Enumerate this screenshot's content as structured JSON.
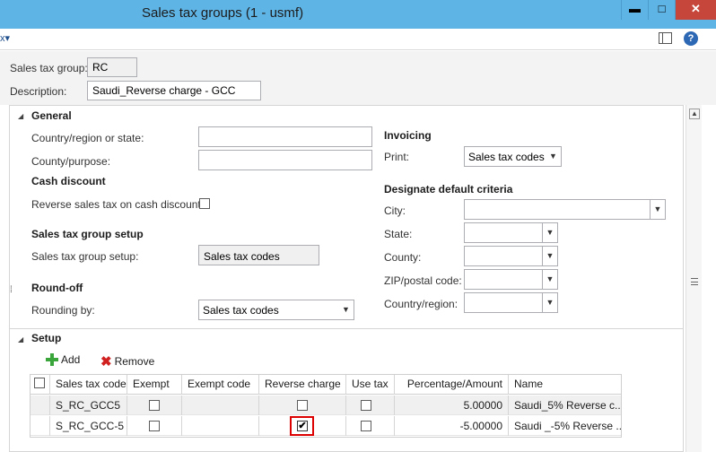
{
  "window": {
    "title": "Sales tax groups (1 - usmf)",
    "min_label": "▬",
    "max_label": "□",
    "close_label": "✕"
  },
  "cmdbar": {
    "menu_label": "x▾",
    "help_label": "?"
  },
  "header": {
    "group_label": "Sales tax group:",
    "group_value": "RC",
    "desc_label": "Description:",
    "desc_value": "Saudi_Reverse charge - GCC"
  },
  "general": {
    "title": "General",
    "country_label": "Country/region or state:",
    "county_label": "County/purpose:",
    "cash_discount_head": "Cash discount",
    "reverse_tax_label": "Reverse sales tax on cash discount:",
    "setup_head": "Sales tax group setup",
    "setup_label": "Sales tax group setup:",
    "setup_value": "Sales tax codes",
    "roundoff_head": "Round-off",
    "rounding_label": "Rounding by:",
    "rounding_value": "Sales tax codes",
    "invoicing_head": "Invoicing",
    "print_label": "Print:",
    "print_value": "Sales tax codes",
    "criteria_head": "Designate default criteria",
    "city_label": "City:",
    "state_label": "State:",
    "county2_label": "County:",
    "zip_label": "ZIP/postal code:",
    "country2_label": "Country/region:"
  },
  "setup": {
    "title": "Setup",
    "add_label": "Add",
    "remove_label": "Remove",
    "columns": [
      "Sales tax code",
      "Exempt",
      "Exempt code",
      "Reverse charge",
      "Use tax",
      "Percentage/Amount",
      "Name"
    ],
    "rows": [
      {
        "code": "S_RC_GCC5",
        "exempt": false,
        "exempt_code": "",
        "reverse_charge": false,
        "use_tax": false,
        "amount": "5.00000",
        "name": "Saudi_5% Reverse c..."
      },
      {
        "code": "S_RC_GCC-5",
        "exempt": false,
        "exempt_code": "",
        "reverse_charge": true,
        "use_tax": false,
        "amount": "-5.00000",
        "name": "Saudi _-5% Reverse ..."
      }
    ]
  },
  "icons": {
    "add": "plus-icon",
    "remove": "remove-icon",
    "help": "help-icon",
    "layout": "layout-icon"
  },
  "colors": {
    "titlebar": "#5fb4e6",
    "close": "#c7463c",
    "highlight": "#dd0000"
  }
}
